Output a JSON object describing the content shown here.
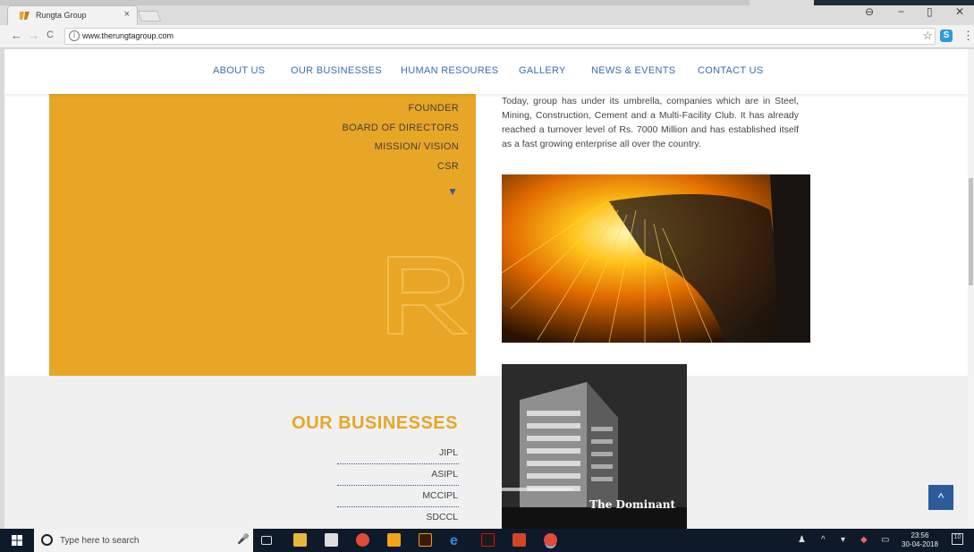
{
  "browser": {
    "tab_title": "Rungta Group",
    "tab_close": "×",
    "url": "www.therungtagroup.com",
    "back": "←",
    "forward": "→",
    "reload": "C",
    "star": "☆",
    "extension_label": "S",
    "menu": "⋮",
    "window_controls": {
      "profile": "⊖",
      "minimize": "−",
      "maximize": "▯",
      "close": "✕"
    }
  },
  "site_nav": {
    "items": [
      "ABOUT US",
      "OUR BUSINESSES",
      "HUMAN RESOURES",
      "GALLERY",
      "NEWS & EVENTS",
      "CONTACT US"
    ]
  },
  "about_menu": {
    "items": [
      "FOUNDER",
      "BOARD OF DIRECTORS",
      "MISSION/ VISION",
      "CSR"
    ],
    "more_arrow": "▼"
  },
  "about_text": "Today, group has under its umbrella, companies which are in Steel, Mining, Construction, Cement and a Multi-Facility Club. It has already reached a turnover level of Rs. 7000 Million and has established itself as a fast growing enterprise all over the country.",
  "businesses": {
    "heading": "OUR BUSINESSES",
    "items": [
      "JIPL",
      "ASIPL",
      "MCCIPL",
      "SDCCL"
    ]
  },
  "building_caption": "The Dominant",
  "to_top": "^",
  "colors": {
    "gold": "#e8a626",
    "nav_blue": "#3a6fa8",
    "accent_blue": "#2b5b9a"
  },
  "taskbar": {
    "search_placeholder": "Type here to search",
    "time": "23:56",
    "date": "30-04-2018",
    "notification_count": "10"
  }
}
